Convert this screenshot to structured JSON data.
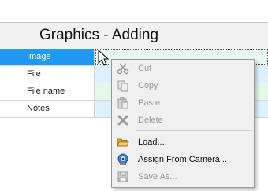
{
  "grid": {
    "title": "Graphics - Adding",
    "rows": [
      {
        "label": "Image"
      },
      {
        "label": "File"
      },
      {
        "label": "File name"
      },
      {
        "label": "Notes"
      }
    ]
  },
  "context_menu": {
    "items": [
      {
        "label": "Cut",
        "icon": "scissors-icon",
        "enabled": false
      },
      {
        "label": "Copy",
        "icon": "copy-icon",
        "enabled": false
      },
      {
        "label": "Paste",
        "icon": "paste-icon",
        "enabled": false
      },
      {
        "label": "Delete",
        "icon": "delete-x-icon",
        "enabled": false
      },
      {
        "label": "Load...",
        "icon": "folder-open-icon",
        "enabled": true
      },
      {
        "label": "Assign From Camera...",
        "icon": "webcam-icon",
        "enabled": true
      },
      {
        "label": "Save As...",
        "icon": "floppy-disk-icon",
        "enabled": false
      }
    ]
  },
  "colors": {
    "selected_label_bg": "#1e9af4",
    "selected_value_bg": "#e9f7f3",
    "menu_bg": "#f0f0f0"
  }
}
